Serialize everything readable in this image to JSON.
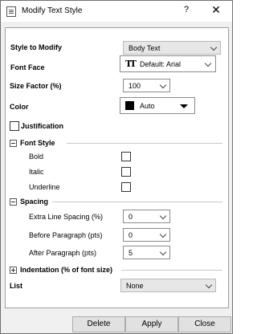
{
  "window": {
    "title": "Modify Text Style",
    "help": "?",
    "close": "✕"
  },
  "fields": {
    "style_label": "Style to Modify",
    "style_value": "Body Text",
    "font_face_label": "Font Face",
    "font_face_icon": "truetype-icon",
    "font_face_value": "Default: Arial",
    "size_label": "Size Factor (%)",
    "size_value": "100",
    "color_label": "Color",
    "color_value": "Auto",
    "color_swatch": "#000000",
    "justification_label": "Justification"
  },
  "font_style": {
    "header": "Font Style",
    "bold": "Bold",
    "italic": "Italic",
    "underline": "Underline"
  },
  "spacing": {
    "header": "Spacing",
    "extra_label": "Extra Line Spacing (%)",
    "extra_value": "0",
    "before_label": "Before Paragraph (pts)",
    "before_value": "0",
    "after_label": "After Paragraph (pts)",
    "after_value": "5"
  },
  "indentation": {
    "header": "Indentation (% of font size)"
  },
  "list": {
    "label": "List",
    "value": "None"
  },
  "buttons": {
    "delete": "Delete",
    "apply": "Apply",
    "close": "Close"
  }
}
